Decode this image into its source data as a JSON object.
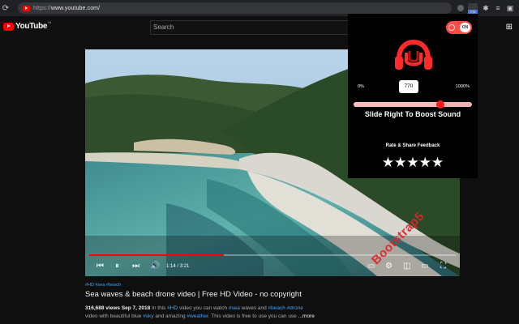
{
  "browser": {
    "url_scheme": "https://",
    "url_host": "www.youtube.com/",
    "extension_badge": "770"
  },
  "youtube": {
    "logo_text": "YouTube",
    "logo_suffix": "IN",
    "search_placeholder": "Search"
  },
  "player": {
    "current_time": "1:14",
    "duration": "3:21",
    "time_separator": " / ",
    "progress": 0.368
  },
  "video": {
    "tags": "#HD #sea #beach",
    "title": "Sea waves & beach drone video | Free HD Video - no copyright",
    "views": "316,688 views",
    "date": "Sep 7, 2018",
    "desc_line1_a": "In this ",
    "desc_line1_hd": "#HD",
    "desc_line1_b": " video you can watch ",
    "desc_line1_sea": "#sea",
    "desc_line1_c": " waves and ",
    "desc_line1_beach": "#beach",
    "desc_line1_d": " ",
    "desc_line1_drone": "#drone",
    "desc_line2_a": "video with beautiful blue ",
    "desc_line2_sky": "#sky",
    "desc_line2_b": " and amazing ",
    "desc_line2_weather": "#weather",
    "desc_line2_c": ". This video is free to use you can use ",
    "more": "...more"
  },
  "extension": {
    "toggle_label": "ON",
    "range_min": "0%",
    "range_max": "1000%",
    "current_value": "770",
    "boost_fraction": 0.73,
    "boost_label": "Slide Right To Boost Sound",
    "feedback_label": "Rate & Share Feedback",
    "stars": [
      "★",
      "★",
      "★",
      "★",
      "★"
    ],
    "accent_color": "#ff2a2a"
  },
  "watermark": "Bootstrap5"
}
